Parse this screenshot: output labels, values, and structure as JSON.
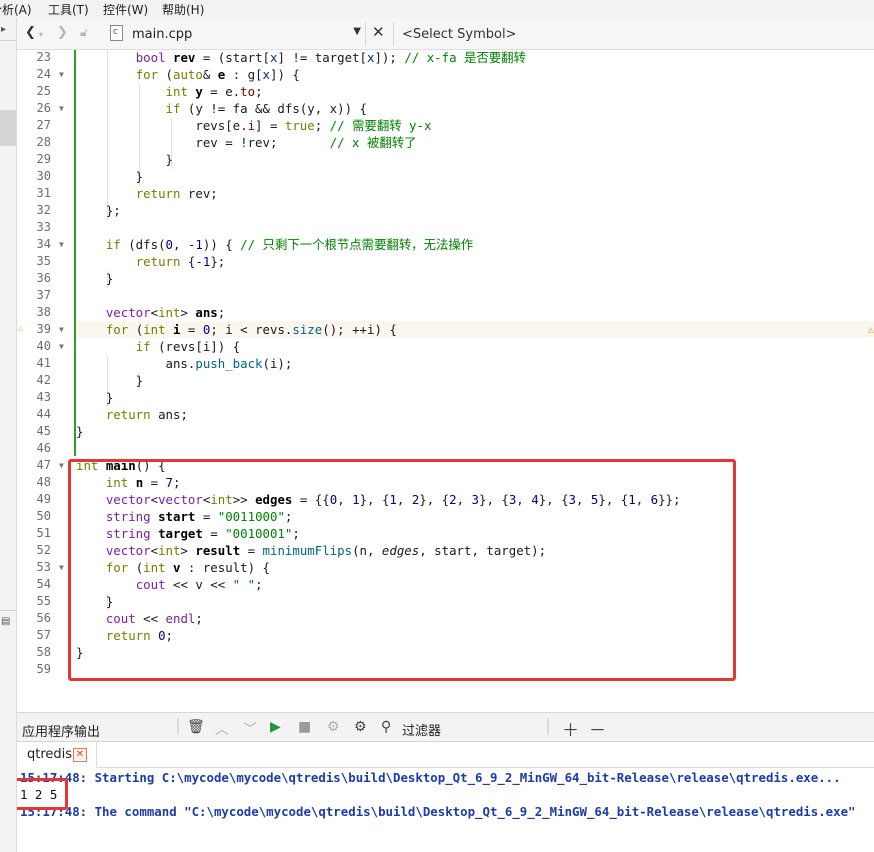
{
  "menu": [
    "分析(A)",
    "工具(T)",
    "控件(W)",
    "帮助(H)"
  ],
  "toolbar": {
    "back": "‹",
    "forward": "›",
    "file_name": "main.cpp",
    "symbol_placeholder": "<Select Symbol>"
  },
  "lines": [
    {
      "n": "23",
      "fold": false,
      "tokens": [
        [
          "pl",
          "        "
        ],
        [
          "ty",
          "bool "
        ],
        [
          "id",
          "rev"
        ],
        [
          "pl",
          " = (start["
        ],
        [
          "var",
          "x"
        ],
        [
          "pl",
          "] != target["
        ],
        [
          "var",
          "x"
        ],
        [
          "pl",
          "]); "
        ],
        [
          "cm",
          "// x-fa 是否要翻转"
        ]
      ]
    },
    {
      "n": "24",
      "fold": true,
      "tokens": [
        [
          "pl",
          "        "
        ],
        [
          "kw",
          "for"
        ],
        [
          "pl",
          " ("
        ],
        [
          "kw",
          "auto"
        ],
        [
          "pl",
          "& "
        ],
        [
          "id",
          "e"
        ],
        [
          "pl",
          " : g["
        ],
        [
          "var",
          "x"
        ],
        [
          "pl",
          "]) {"
        ]
      ]
    },
    {
      "n": "25",
      "fold": false,
      "tokens": [
        [
          "pl",
          "            "
        ],
        [
          "kw",
          "int "
        ],
        [
          "id",
          "y"
        ],
        [
          "pl",
          " = e."
        ],
        [
          "mem",
          "to"
        ],
        [
          "pl",
          ";"
        ]
      ]
    },
    {
      "n": "26",
      "fold": true,
      "tokens": [
        [
          "pl",
          "            "
        ],
        [
          "kw",
          "if"
        ],
        [
          "pl",
          " (y != fa && dfs(y, x)) {"
        ]
      ]
    },
    {
      "n": "27",
      "fold": false,
      "tokens": [
        [
          "pl",
          "                revs[e."
        ],
        [
          "mem",
          "i"
        ],
        [
          "pl",
          "] = "
        ],
        [
          "kw",
          "true"
        ],
        [
          "pl",
          "; "
        ],
        [
          "cm",
          "// 需要翻转 y-x"
        ]
      ]
    },
    {
      "n": "28",
      "fold": false,
      "tokens": [
        [
          "pl",
          "                rev = !rev;       "
        ],
        [
          "cm",
          "// x 被翻转了"
        ]
      ]
    },
    {
      "n": "29",
      "fold": false,
      "tokens": [
        [
          "pl",
          "            }"
        ]
      ]
    },
    {
      "n": "30",
      "fold": false,
      "tokens": [
        [
          "pl",
          "        }"
        ]
      ]
    },
    {
      "n": "31",
      "fold": false,
      "tokens": [
        [
          "pl",
          "        "
        ],
        [
          "kw",
          "return"
        ],
        [
          "pl",
          " rev;"
        ]
      ]
    },
    {
      "n": "32",
      "fold": false,
      "tokens": [
        [
          "pl",
          "    };"
        ]
      ]
    },
    {
      "n": "33",
      "fold": false,
      "tokens": []
    },
    {
      "n": "34",
      "fold": true,
      "tokens": [
        [
          "pl",
          "    "
        ],
        [
          "kw",
          "if"
        ],
        [
          "pl",
          " (dfs("
        ],
        [
          "num",
          "0"
        ],
        [
          "pl",
          ", -"
        ],
        [
          "num",
          "1"
        ],
        [
          "pl",
          ")) { "
        ],
        [
          "cm",
          "// 只剩下一个根节点需要翻转，无法操作"
        ]
      ]
    },
    {
      "n": "35",
      "fold": false,
      "tokens": [
        [
          "pl",
          "        "
        ],
        [
          "kw",
          "return"
        ],
        [
          "pl",
          " {-"
        ],
        [
          "num",
          "1"
        ],
        [
          "pl",
          "};"
        ]
      ]
    },
    {
      "n": "36",
      "fold": false,
      "tokens": [
        [
          "pl",
          "    }"
        ]
      ]
    },
    {
      "n": "37",
      "fold": false,
      "tokens": []
    },
    {
      "n": "38",
      "fold": false,
      "tokens": [
        [
          "pl",
          "    "
        ],
        [
          "ty",
          "vector"
        ],
        [
          "pl",
          "<"
        ],
        [
          "kw",
          "int"
        ],
        [
          "pl",
          "> "
        ],
        [
          "id",
          "ans"
        ],
        [
          "pl",
          ";"
        ]
      ]
    },
    {
      "n": "39",
      "fold": true,
      "warn": true,
      "tokens": [
        [
          "pl",
          "    "
        ],
        [
          "kw",
          "for"
        ],
        [
          "pl",
          " ("
        ],
        [
          "kw",
          "int "
        ],
        [
          "id",
          "i"
        ],
        [
          "pl",
          " = "
        ],
        [
          "num",
          "0"
        ],
        [
          "pl",
          "; i < revs."
        ],
        [
          "fn",
          "size"
        ],
        [
          "pl",
          "(); ++i) {"
        ]
      ]
    },
    {
      "n": "40",
      "fold": true,
      "tokens": [
        [
          "pl",
          "        "
        ],
        [
          "kw",
          "if"
        ],
        [
          "pl",
          " (revs[i]) {"
        ]
      ]
    },
    {
      "n": "41",
      "fold": false,
      "tokens": [
        [
          "pl",
          "            ans."
        ],
        [
          "fn",
          "push_back"
        ],
        [
          "pl",
          "(i);"
        ]
      ]
    },
    {
      "n": "42",
      "fold": false,
      "tokens": [
        [
          "pl",
          "        }"
        ]
      ]
    },
    {
      "n": "43",
      "fold": false,
      "tokens": [
        [
          "pl",
          "    }"
        ]
      ]
    },
    {
      "n": "44",
      "fold": false,
      "tokens": [
        [
          "pl",
          "    "
        ],
        [
          "kw",
          "return"
        ],
        [
          "pl",
          " ans;"
        ]
      ]
    },
    {
      "n": "45",
      "fold": false,
      "tokens": [
        [
          "pl",
          "}"
        ]
      ]
    },
    {
      "n": "46",
      "fold": false,
      "tokens": []
    },
    {
      "n": "47",
      "fold": true,
      "tokens": [
        [
          "kw",
          "int "
        ],
        [
          "id",
          "main"
        ],
        [
          "pl",
          "() {"
        ]
      ]
    },
    {
      "n": "48",
      "fold": false,
      "tokens": [
        [
          "pl",
          "    "
        ],
        [
          "kw",
          "int "
        ],
        [
          "id",
          "n"
        ],
        [
          "pl",
          " = "
        ],
        [
          "num",
          "7"
        ],
        [
          "pl",
          ";"
        ]
      ]
    },
    {
      "n": "49",
      "fold": false,
      "tokens": [
        [
          "pl",
          "    "
        ],
        [
          "ty",
          "vector"
        ],
        [
          "pl",
          "<"
        ],
        [
          "ty",
          "vector"
        ],
        [
          "pl",
          "<"
        ],
        [
          "kw",
          "int"
        ],
        [
          "pl",
          ">> "
        ],
        [
          "id",
          "edges"
        ],
        [
          "pl",
          " = {{"
        ],
        [
          "num",
          "0"
        ],
        [
          "pl",
          ", "
        ],
        [
          "num",
          "1"
        ],
        [
          "pl",
          "}, {"
        ],
        [
          "num",
          "1"
        ],
        [
          "pl",
          ", "
        ],
        [
          "num",
          "2"
        ],
        [
          "pl",
          "}, {"
        ],
        [
          "num",
          "2"
        ],
        [
          "pl",
          ", "
        ],
        [
          "num",
          "3"
        ],
        [
          "pl",
          "}, {"
        ],
        [
          "num",
          "3"
        ],
        [
          "pl",
          ", "
        ],
        [
          "num",
          "4"
        ],
        [
          "pl",
          "}, {"
        ],
        [
          "num",
          "3"
        ],
        [
          "pl",
          ", "
        ],
        [
          "num",
          "5"
        ],
        [
          "pl",
          "}, {"
        ],
        [
          "num",
          "1"
        ],
        [
          "pl",
          ", "
        ],
        [
          "num",
          "6"
        ],
        [
          "pl",
          "}};"
        ]
      ]
    },
    {
      "n": "50",
      "fold": false,
      "tokens": [
        [
          "pl",
          "    "
        ],
        [
          "ty",
          "string "
        ],
        [
          "id",
          "start"
        ],
        [
          "pl",
          " = "
        ],
        [
          "str",
          "\"0011000\""
        ],
        [
          "pl",
          ";"
        ]
      ]
    },
    {
      "n": "51",
      "fold": false,
      "tokens": [
        [
          "pl",
          "    "
        ],
        [
          "ty",
          "string "
        ],
        [
          "id",
          "target"
        ],
        [
          "pl",
          " = "
        ],
        [
          "str",
          "\"0010001\""
        ],
        [
          "pl",
          ";"
        ]
      ]
    },
    {
      "n": "52",
      "fold": false,
      "tokens": [
        [
          "pl",
          "    "
        ],
        [
          "ty",
          "vector"
        ],
        [
          "pl",
          "<"
        ],
        [
          "kw",
          "int"
        ],
        [
          "pl",
          "> "
        ],
        [
          "id",
          "result"
        ],
        [
          "pl",
          " = "
        ],
        [
          "fn",
          "minimumFlips"
        ],
        [
          "pl",
          "(n, "
        ],
        [
          "it",
          "edges"
        ],
        [
          "pl",
          ", start, target);"
        ]
      ]
    },
    {
      "n": "53",
      "fold": true,
      "tokens": [
        [
          "pl",
          "    "
        ],
        [
          "kw",
          "for"
        ],
        [
          "pl",
          " ("
        ],
        [
          "kw",
          "int "
        ],
        [
          "id",
          "v"
        ],
        [
          "pl",
          " : result) {"
        ]
      ]
    },
    {
      "n": "54",
      "fold": false,
      "tokens": [
        [
          "pl",
          "        "
        ],
        [
          "ty",
          "cout"
        ],
        [
          "pl",
          " << v << "
        ],
        [
          "str",
          "\" \""
        ],
        [
          "pl",
          ";"
        ]
      ]
    },
    {
      "n": "55",
      "fold": false,
      "tokens": [
        [
          "pl",
          "    }"
        ]
      ]
    },
    {
      "n": "56",
      "fold": false,
      "tokens": [
        [
          "pl",
          "    "
        ],
        [
          "ty",
          "cout"
        ],
        [
          "pl",
          " << "
        ],
        [
          "ty",
          "endl"
        ],
        [
          "pl",
          ";"
        ]
      ]
    },
    {
      "n": "57",
      "fold": false,
      "tokens": [
        [
          "pl",
          "    "
        ],
        [
          "kw",
          "return"
        ],
        [
          "pl",
          " "
        ],
        [
          "num",
          "0"
        ],
        [
          "pl",
          ";"
        ]
      ]
    },
    {
      "n": "58",
      "fold": false,
      "tokens": [
        [
          "pl",
          "}"
        ]
      ]
    },
    {
      "n": "59",
      "fold": false,
      "tokens": []
    }
  ],
  "output": {
    "title": "应用程序输出",
    "filter_label": "过滤器",
    "tab_name": "qtredis",
    "lines": [
      {
        "style": "blue",
        "text": "15:17:48: Starting C:\\mycode\\mycode\\qtredis\\build\\Desktop_Qt_6_9_2_MinGW_64_bit-Release\\release\\qtredis.exe..."
      },
      {
        "style": "plain",
        "text": "1 2 5"
      },
      {
        "style": "blue",
        "text": "15:17:48: The command \"C:\\mycode\\mycode\\qtredis\\build\\Desktop_Qt_6_9_2_MinGW_64_bit-Release\\release\\qtredis.exe\""
      }
    ]
  },
  "colors": {
    "keyword": "#7a7a00",
    "type": "#7a1fa0",
    "string": "#008000",
    "comment": "#008000",
    "number": "#000080",
    "function": "#00677c",
    "highlight_box": "#e53535",
    "output_blue": "#1d3ba8",
    "change_marker": "#2aa12a"
  }
}
